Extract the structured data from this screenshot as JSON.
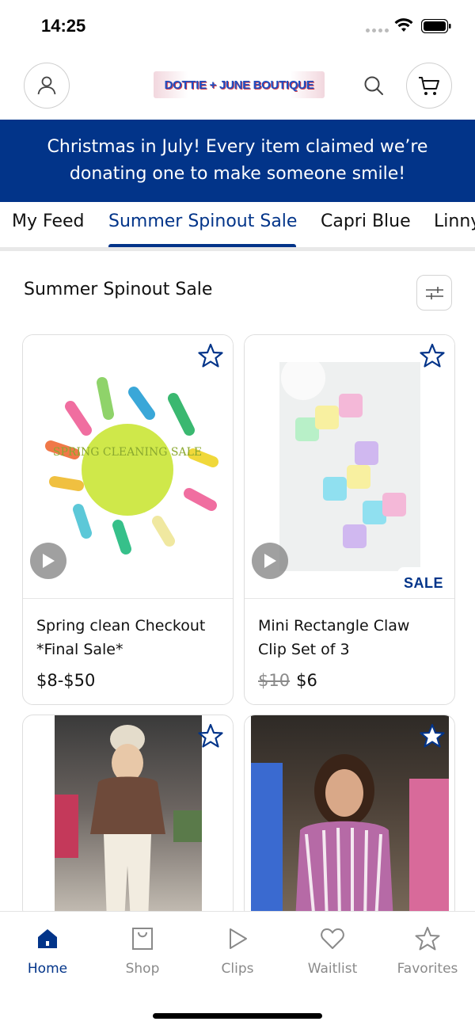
{
  "status": {
    "time": "14:25"
  },
  "header": {
    "logo_text": "DOTTIE + JUNE BOUTIQUE"
  },
  "banner": {
    "text": "Christmas in July! Every item claimed we’re donating one to make someone smile!"
  },
  "tabs": [
    {
      "label": "My Feed",
      "active": false
    },
    {
      "label": "Summer Spinout Sale",
      "active": true
    },
    {
      "label": "Capri Blue",
      "active": false
    },
    {
      "label": "Linny",
      "active": false
    }
  ],
  "section": {
    "title": "Summer Spinout Sale"
  },
  "products": [
    {
      "title": "Spring clean Checkout *Final Sale*",
      "price": "$8-$50",
      "old_price": "",
      "image_text": "SPRING CLEANING SALE",
      "has_video": true,
      "badge": ""
    },
    {
      "title": "Mini Rectangle Claw Clip Set of 3",
      "price": "$6",
      "old_price": "$10",
      "has_video": true,
      "badge": "SALE"
    },
    {
      "title": "",
      "price": "",
      "old_price": "",
      "has_video": false,
      "badge": ""
    },
    {
      "title": "",
      "price": "",
      "old_price": "",
      "has_video": false,
      "badge": ""
    }
  ],
  "nav": [
    {
      "label": "Home",
      "icon": "home-icon",
      "active": true
    },
    {
      "label": "Shop",
      "icon": "shopping-bag-icon",
      "active": false
    },
    {
      "label": "Clips",
      "icon": "play-icon",
      "active": false
    },
    {
      "label": "Waitlist",
      "icon": "heart-icon",
      "active": false
    },
    {
      "label": "Favorites",
      "icon": "star-icon",
      "active": false
    }
  ],
  "colors": {
    "brand": "#023489",
    "muted": "#8a8a8a"
  }
}
